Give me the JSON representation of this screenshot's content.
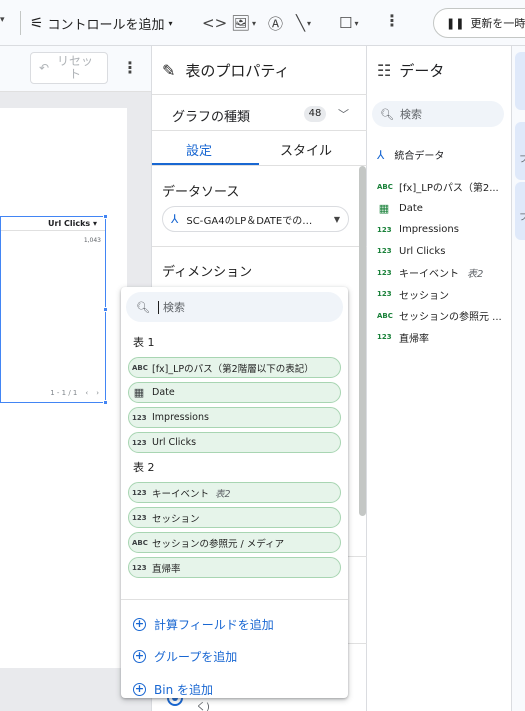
{
  "toolbar": {
    "add_control_label": "コントロールを追加",
    "update_label": "更新を一時"
  },
  "canvas": {
    "reset_label": "リセット",
    "table_header": "Url Clicks",
    "table_value": "1,043",
    "pager": "1 - 1 / 1"
  },
  "properties": {
    "title": "表のプロパティ",
    "chart_type_label": "グラフの種類",
    "chart_type_count": "48",
    "tabs": [
      "設定",
      "スタイル"
    ],
    "data_source_label": "データソース",
    "data_source_value": "SC-GA4のLP＆DATEでの…",
    "dimension_label": "ディメンション",
    "radio_label": "く)"
  },
  "data_panel": {
    "title": "データ",
    "search_placeholder": "検索",
    "merged_label": "統合データ",
    "fields": [
      {
        "type": "ABC",
        "name": "[fx]_LPのパス（第2..."
      },
      {
        "type": "date",
        "name": "Date"
      },
      {
        "type": "123",
        "name": "Impressions"
      },
      {
        "type": "123",
        "name": "Url Clicks"
      },
      {
        "type": "123",
        "name": "キーイベント",
        "suffix": "表2"
      },
      {
        "type": "123",
        "name": "セッション"
      },
      {
        "type": "ABC",
        "name": "セッションの参照元 ..."
      },
      {
        "type": "123",
        "name": "直帰率"
      }
    ]
  },
  "right_strip": {
    "glyphs": [
      "フ",
      "フ"
    ]
  },
  "dropdown": {
    "search_placeholder": "検索",
    "group1_label": "表 1",
    "group1_fields": [
      {
        "type": "ABC",
        "name": "[fx]_LPのパス（第2階層以下の表記）"
      },
      {
        "type": "date",
        "name": "Date"
      },
      {
        "type": "123",
        "name": "Impressions"
      },
      {
        "type": "123",
        "name": "Url Clicks"
      }
    ],
    "group2_label": "表 2",
    "group2_fields": [
      {
        "type": "123",
        "name": "キーイベント",
        "suffix": "表2"
      },
      {
        "type": "123",
        "name": "セッション"
      },
      {
        "type": "ABC",
        "name": "セッションの参照元 / メディア"
      },
      {
        "type": "123",
        "name": "直帰率"
      }
    ],
    "actions": [
      "計算フィールドを追加",
      "グループを追加",
      "Bin を追加"
    ]
  }
}
